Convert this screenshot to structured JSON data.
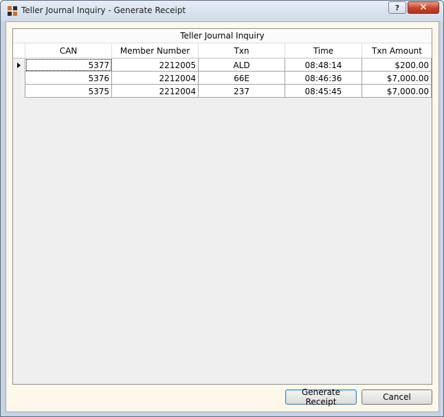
{
  "window": {
    "title": "Teller Journal Inquiry - Generate Receipt",
    "help_label": "?",
    "close_label": "✕"
  },
  "grid": {
    "caption": "Teller Journal Inquiry",
    "columns": [
      "CAN",
      "Member Number",
      "Txn",
      "Time",
      "Txn Amount"
    ],
    "rows": [
      {
        "can": "5377",
        "member": "2212005",
        "txn": "ALD",
        "time": "08:48:14",
        "amount": "$200.00",
        "current": true
      },
      {
        "can": "5376",
        "member": "2212004",
        "txn": "66E",
        "time": "08:46:36",
        "amount": "$7,000.00",
        "current": false
      },
      {
        "can": "5375",
        "member": "2212004",
        "txn": "237",
        "time": "08:45:45",
        "amount": "$7,000.00",
        "current": false
      }
    ]
  },
  "buttons": {
    "generate_label": "Generate Receipt",
    "cancel_label": "Cancel"
  },
  "colors": {
    "client_bg": "#fdf8ea",
    "close_red": "#c7432a",
    "grid_bg": "#efefef"
  }
}
